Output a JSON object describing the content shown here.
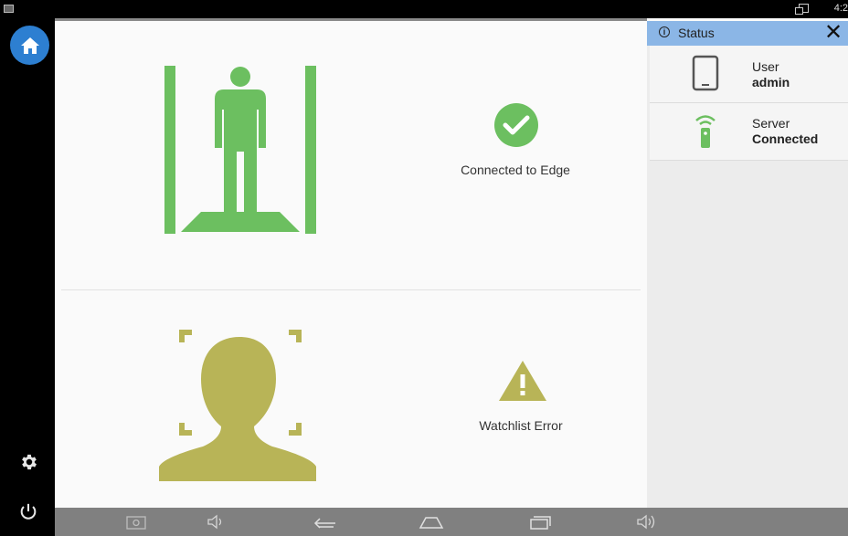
{
  "system_bar": {
    "clock": "4:2"
  },
  "status_panel": {
    "title": "Status",
    "rows": [
      {
        "label": "User",
        "value": "admin",
        "icon": "tablet-icon"
      },
      {
        "label": "Server",
        "value": "Connected",
        "icon": "wifi-remote-icon"
      }
    ]
  },
  "cards": {
    "edge": {
      "label": "Connected to Edge",
      "icon": "check-circle-icon",
      "color": "#6cbf60"
    },
    "watchlist": {
      "label": "Watchlist Error",
      "icon": "warning-triangle-icon",
      "color": "#b8b457"
    }
  },
  "colors": {
    "accent": "#2d7fd1",
    "success": "#6cbf60",
    "warning": "#b8b457",
    "panel_header": "#8bb6e6"
  }
}
